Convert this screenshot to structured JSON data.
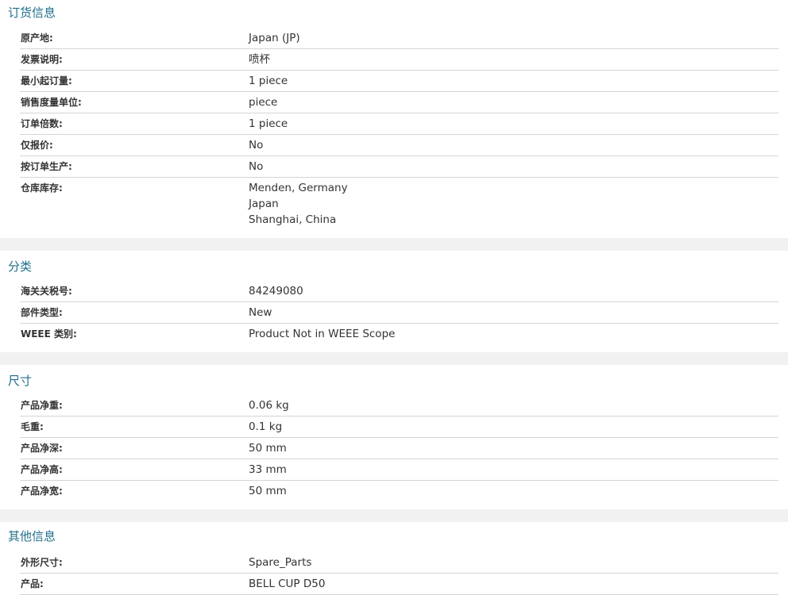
{
  "sections": [
    {
      "title": "订货信息",
      "rows": [
        {
          "label": "原产地:",
          "value": [
            "Japan (JP)"
          ]
        },
        {
          "label": "发票说明:",
          "value": [
            "喷杯"
          ]
        },
        {
          "label": "最小起订量:",
          "value": [
            "1 piece"
          ]
        },
        {
          "label": "销售度量单位:",
          "value": [
            "piece"
          ]
        },
        {
          "label": "订单倍数:",
          "value": [
            "1 piece"
          ]
        },
        {
          "label": "仅报价:",
          "value": [
            "No"
          ]
        },
        {
          "label": "按订单生产:",
          "value": [
            "No"
          ]
        },
        {
          "label": "仓库库存:",
          "value": [
            "Menden, Germany",
            "Japan",
            "Shanghai, China"
          ]
        }
      ]
    },
    {
      "title": "分类",
      "rows": [
        {
          "label": "海关关税号:",
          "value": [
            "84249080"
          ]
        },
        {
          "label": "部件类型:",
          "value": [
            "New"
          ]
        },
        {
          "label": "WEEE 类别:",
          "value": [
            "Product Not in WEEE Scope"
          ]
        }
      ]
    },
    {
      "title": "尺寸",
      "rows": [
        {
          "label": "产品净重:",
          "value": [
            "0.06 kg"
          ]
        },
        {
          "label": "毛重:",
          "value": [
            "0.1 kg"
          ]
        },
        {
          "label": "产品净深:",
          "value": [
            "50 mm"
          ]
        },
        {
          "label": "产品净高:",
          "value": [
            "33 mm"
          ]
        },
        {
          "label": "产品净宽:",
          "value": [
            "50 mm"
          ]
        }
      ]
    },
    {
      "title": "其他信息",
      "rows": [
        {
          "label": "外形尺寸:",
          "value": [
            "Spare_Parts"
          ]
        },
        {
          "label": "产品:",
          "value": [
            "BELL CUP D50"
          ]
        }
      ]
    }
  ]
}
